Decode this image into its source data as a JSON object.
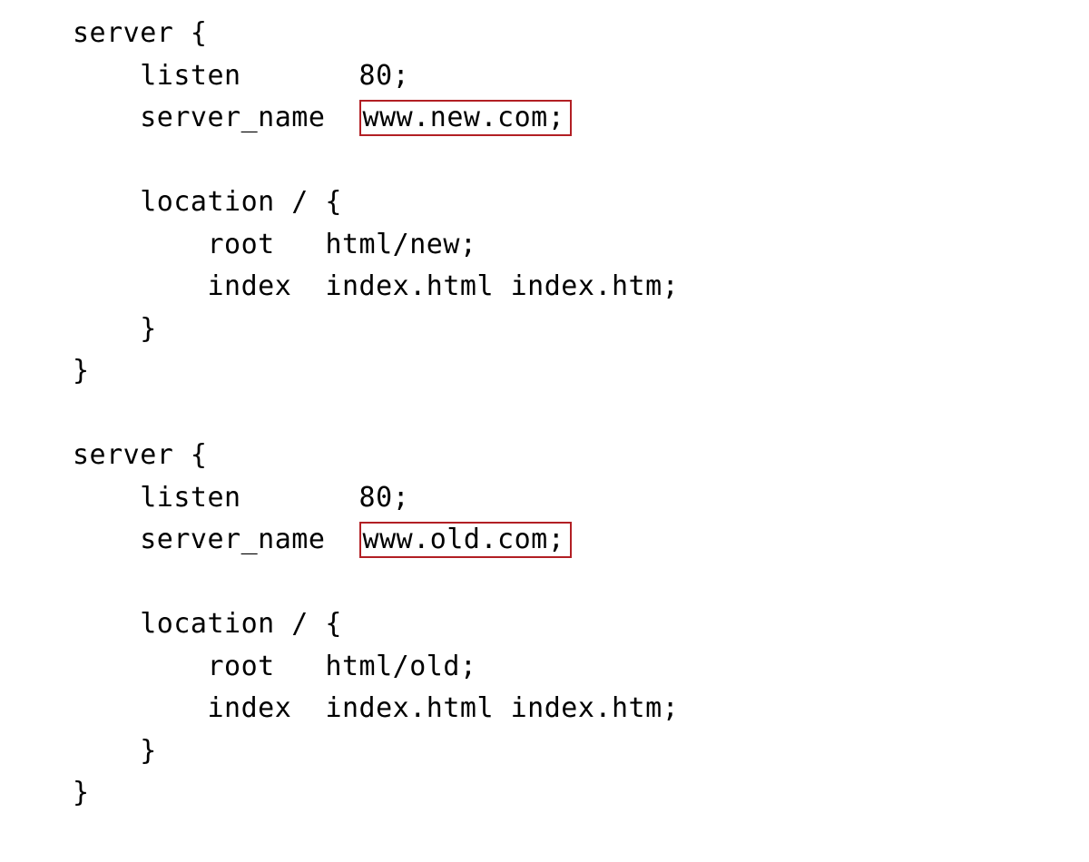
{
  "block1": {
    "server_open": "server {",
    "listen_key": "    listen       ",
    "listen_val": "80;",
    "name_key": "    server_name  ",
    "name_val": "www.new.com;",
    "loc_open": "    location / {",
    "root_key": "        root   ",
    "root_val": "html/new;",
    "index_key": "        index  ",
    "index_val": "index.html index.htm;",
    "loc_close": "    }",
    "server_close": "}"
  },
  "block2": {
    "server_open": "server {",
    "listen_key": "    listen       ",
    "listen_val": "80;",
    "name_key": "    server_name  ",
    "name_val": "www.old.com;",
    "loc_open": "    location / {",
    "root_key": "        root   ",
    "root_val": "html/old;",
    "index_key": "        index  ",
    "index_val": "index.html index.htm;",
    "loc_close": "    }",
    "server_close": "}"
  },
  "highlight_color": "#b21f24"
}
